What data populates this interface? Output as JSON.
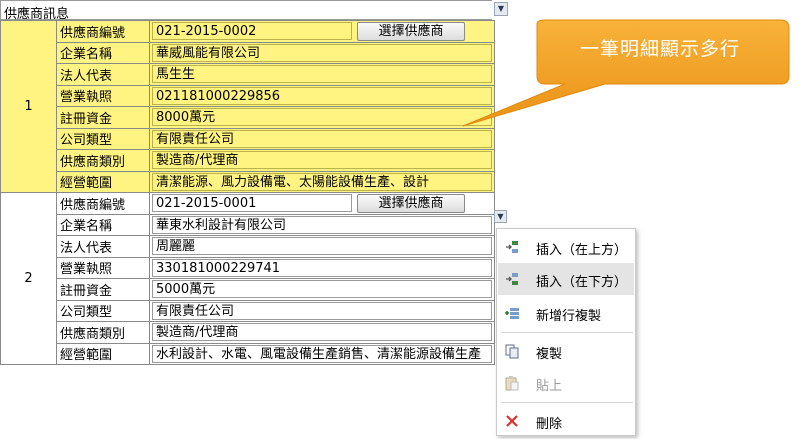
{
  "header": {
    "title": "供應商訊息"
  },
  "callout": {
    "text": "一筆明細顯示多行"
  },
  "button_label": "選擇供應商",
  "records": [
    {
      "index": "1",
      "fields": [
        {
          "label": "供應商編號",
          "value": "021-2015-0002"
        },
        {
          "label": "企業名稱",
          "value": "華威風能有限公司"
        },
        {
          "label": "法人代表",
          "value": "馬生生"
        },
        {
          "label": "營業執照",
          "value": "021181000229856"
        },
        {
          "label": "註冊資金",
          "value": "8000萬元"
        },
        {
          "label": "公司類型",
          "value": "有限責任公司"
        },
        {
          "label": "供應商類別",
          "value": "製造商/代理商"
        },
        {
          "label": "經營範圍",
          "value": "清潔能源、風力設備電、太陽能設備生產、設計"
        }
      ]
    },
    {
      "index": "2",
      "fields": [
        {
          "label": "供應商編號",
          "value": "021-2015-0001"
        },
        {
          "label": "企業名稱",
          "value": "華東水利設計有限公司"
        },
        {
          "label": "法人代表",
          "value": "周麗麗"
        },
        {
          "label": "營業執照",
          "value": "330181000229741"
        },
        {
          "label": "註冊資金",
          "value": "5000萬元"
        },
        {
          "label": "公司類型",
          "value": "有限責任公司"
        },
        {
          "label": "供應商類別",
          "value": "製造商/代理商"
        },
        {
          "label": "經營範圍",
          "value": "水利設計、水電、風電設備生產銷售、清潔能源設備生產"
        }
      ]
    }
  ],
  "context_menu": {
    "items": [
      {
        "label": "插入（在上方）",
        "icon": "insert-above-icon"
      },
      {
        "label": "插入（在下方）",
        "icon": "insert-below-icon"
      },
      {
        "label": "新增行複製",
        "icon": "add-row-copy-icon"
      },
      {
        "label": "複製",
        "icon": "copy-icon"
      },
      {
        "label": "貼上",
        "icon": "paste-icon"
      },
      {
        "label": "刪除",
        "icon": "delete-icon"
      }
    ]
  },
  "colors": {
    "highlight": "#fff482",
    "callout": "#f5a623",
    "delete": "#d9302c"
  }
}
